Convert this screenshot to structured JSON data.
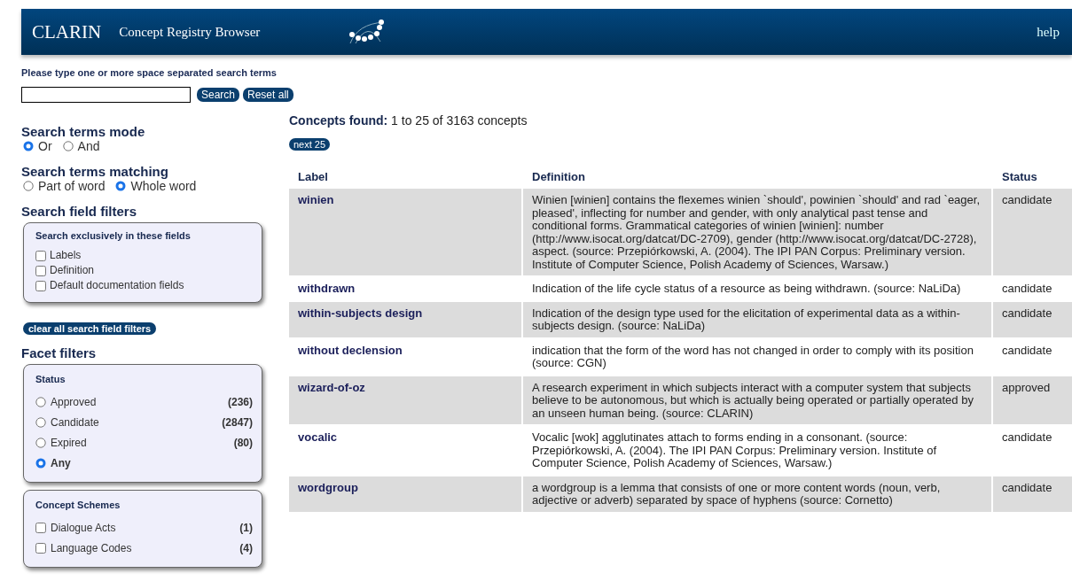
{
  "header": {
    "title": "CLARIN",
    "subtitle": "Concept Registry Browser",
    "help": "help"
  },
  "search": {
    "prompt": "Please type one or more space separated search terms",
    "buttons": [
      "Search",
      "Reset all"
    ]
  },
  "sidebar": {
    "mode": {
      "heading": "Search terms mode",
      "options": [
        {
          "label": "Or",
          "selected": true
        },
        {
          "label": "And",
          "selected": false
        }
      ]
    },
    "matching": {
      "heading": "Search terms matching",
      "options": [
        {
          "label": "Part of word",
          "selected": false
        },
        {
          "label": "Whole word",
          "selected": true
        }
      ]
    },
    "field_filters": {
      "heading": "Search field filters",
      "box_title": "Search exclusively in these fields",
      "options": [
        {
          "label": "Labels",
          "checked": false
        },
        {
          "label": "Definition",
          "checked": false
        },
        {
          "label": "Default documentation fields",
          "checked": false
        }
      ],
      "clear_button": "clear all search field filters"
    },
    "facets": {
      "heading": "Facet filters",
      "groups": [
        {
          "title": "Status",
          "kind": "radio",
          "options": [
            {
              "label": "Approved",
              "count": "(236)",
              "selected": false
            },
            {
              "label": "Candidate",
              "count": "(2847)",
              "selected": false
            },
            {
              "label": "Expired",
              "count": "(80)",
              "selected": false
            },
            {
              "label": "Any",
              "selected": true
            }
          ]
        },
        {
          "title": "Concept Schemes",
          "kind": "checkbox",
          "options": [
            {
              "label": "Dialogue Acts",
              "count": "(1)",
              "checked": false
            },
            {
              "label": "Language Codes",
              "count": "(4)",
              "checked": false
            }
          ]
        }
      ]
    }
  },
  "results": {
    "summary_label": "Concepts found:",
    "summary": "1 to 25 of 3163 concepts",
    "next_button": "next 25",
    "table": {
      "columns": [
        "Label",
        "Definition",
        "Status"
      ],
      "rows": [
        {
          "label": "winien",
          "definition": "Winien [winien] contains the flexemes winien `should', powinien `should' and rad `eager, pleased', inflecting for number and gender, with only analytical past tense and conditional forms. Grammatical categories of winien [winien]: number (http://www.isocat.org/datcat/DC-2709), gender (http://www.isocat.org/datcat/DC-2728), aspect. (source: Przepiórkowski, A. (2004). The IPI PAN Corpus: Preliminary version. Institute of Computer Science, Polish Academy of Sciences, Warsaw.)",
          "status": "candidate"
        },
        {
          "label": "withdrawn",
          "definition": "Indication of the life cycle status of a resource as being withdrawn. (source: NaLiDa)",
          "status": "candidate"
        },
        {
          "label": "within-subjects design",
          "definition": "Indication of the design type used for the elicitation of experimental data as a within-subjects design. (source: NaLiDa)",
          "status": "candidate"
        },
        {
          "label": "without declension",
          "definition": "indication that the form of the word has not changed in order to comply with its position (source: CGN)",
          "status": "candidate"
        },
        {
          "label": "wizard-of-oz",
          "definition": "A research experiment in which subjects interact with a computer system that subjects believe to be autonomous, but which is actually being operated or partially operated by an unseen human being. (source: CLARIN)",
          "status": "approved"
        },
        {
          "label": "vocalic",
          "definition": "Vocalic [wok] agglutinates attach to forms ending in a consonant. (source: Przepiórkowski, A. (2004). The IPI PAN Corpus: Preliminary version. Institute of Computer Science, Polish Academy of Sciences, Warsaw.)",
          "status": "candidate"
        },
        {
          "label": "wordgroup",
          "definition": "a wordgroup is a lemma that consists of one or more content words (noun, verb, adjective or adverb) separated by space of hyphens (source: Cornetto)",
          "status": "candidate"
        }
      ]
    }
  }
}
